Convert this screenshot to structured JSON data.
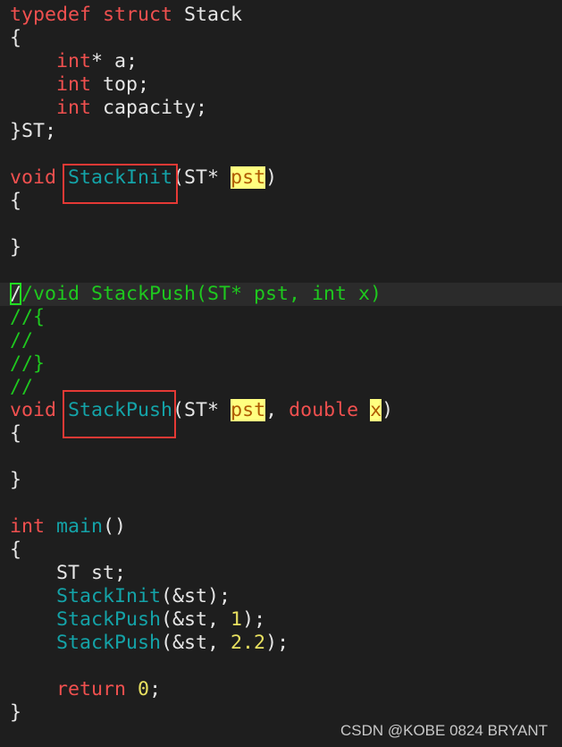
{
  "colors": {
    "background": "#1e1e1e",
    "keyword": "#f0504f",
    "function": "#14a3a8",
    "comment": "#1ec81e",
    "number": "#e8e060",
    "highlight": "#ffff80",
    "annotation_box": "#e53935"
  },
  "code": {
    "current_line": 12,
    "lines": [
      [
        {
          "t": "typedef struct",
          "c": "kw"
        },
        {
          "t": " Stack",
          "c": "tx"
        }
      ],
      [
        {
          "t": "{",
          "c": "tx"
        }
      ],
      [
        {
          "t": "    ",
          "c": "tx"
        },
        {
          "t": "int",
          "c": "kw"
        },
        {
          "t": "* a;",
          "c": "tx"
        }
      ],
      [
        {
          "t": "    ",
          "c": "tx"
        },
        {
          "t": "int",
          "c": "kw"
        },
        {
          "t": " top;",
          "c": "tx"
        }
      ],
      [
        {
          "t": "    ",
          "c": "tx"
        },
        {
          "t": "int",
          "c": "kw"
        },
        {
          "t": " capacity;",
          "c": "tx"
        }
      ],
      [
        {
          "t": "}ST;",
          "c": "tx"
        }
      ],
      [],
      [
        {
          "t": "void",
          "c": "kw"
        },
        {
          "t": " ",
          "c": "tx"
        },
        {
          "t": "StackInit",
          "c": "fn"
        },
        {
          "t": "(ST* ",
          "c": "tx"
        },
        {
          "t": "pst",
          "c": "hl"
        },
        {
          "t": ")",
          "c": "tx"
        }
      ],
      [
        {
          "t": "{",
          "c": "tx"
        }
      ],
      [],
      [
        {
          "t": "}",
          "c": "tx"
        }
      ],
      [],
      [
        {
          "t": "/",
          "c": "cur"
        },
        {
          "t": "/void StackPush(ST* pst, int x)",
          "c": "cm"
        }
      ],
      [
        {
          "t": "//{",
          "c": "cm"
        }
      ],
      [
        {
          "t": "//",
          "c": "cm"
        }
      ],
      [
        {
          "t": "//}",
          "c": "cm"
        }
      ],
      [
        {
          "t": "//",
          "c": "cm"
        }
      ],
      [
        {
          "t": "void",
          "c": "kw"
        },
        {
          "t": " ",
          "c": "tx"
        },
        {
          "t": "StackPush",
          "c": "fn"
        },
        {
          "t": "(ST* ",
          "c": "tx"
        },
        {
          "t": "pst",
          "c": "hl"
        },
        {
          "t": ", ",
          "c": "tx"
        },
        {
          "t": "double",
          "c": "kw"
        },
        {
          "t": " ",
          "c": "tx"
        },
        {
          "t": "x",
          "c": "hl"
        },
        {
          "t": ")",
          "c": "tx"
        }
      ],
      [
        {
          "t": "{",
          "c": "tx"
        }
      ],
      [],
      [
        {
          "t": "}",
          "c": "tx"
        }
      ],
      [],
      [
        {
          "t": "int",
          "c": "kw"
        },
        {
          "t": " ",
          "c": "tx"
        },
        {
          "t": "main",
          "c": "fn"
        },
        {
          "t": "()",
          "c": "tx"
        }
      ],
      [
        {
          "t": "{",
          "c": "tx"
        }
      ],
      [
        {
          "t": "    ST st;",
          "c": "tx"
        }
      ],
      [
        {
          "t": "    ",
          "c": "tx"
        },
        {
          "t": "StackInit",
          "c": "fn"
        },
        {
          "t": "(&st);",
          "c": "tx"
        }
      ],
      [
        {
          "t": "    ",
          "c": "tx"
        },
        {
          "t": "StackPush",
          "c": "fn"
        },
        {
          "t": "(&st, ",
          "c": "tx"
        },
        {
          "t": "1",
          "c": "num"
        },
        {
          "t": ");",
          "c": "tx"
        }
      ],
      [
        {
          "t": "    ",
          "c": "tx"
        },
        {
          "t": "StackPush",
          "c": "fn"
        },
        {
          "t": "(&st, ",
          "c": "tx"
        },
        {
          "t": "2.2",
          "c": "num"
        },
        {
          "t": ");",
          "c": "tx"
        }
      ],
      [],
      [
        {
          "t": "    ",
          "c": "tx"
        },
        {
          "t": "return",
          "c": "kw"
        },
        {
          "t": " ",
          "c": "tx"
        },
        {
          "t": "0",
          "c": "num"
        },
        {
          "t": ";",
          "c": "tx"
        }
      ],
      [
        {
          "t": "}",
          "c": "tx"
        }
      ]
    ]
  },
  "watermark": "CSDN @KOBE 0824 BRYANT"
}
